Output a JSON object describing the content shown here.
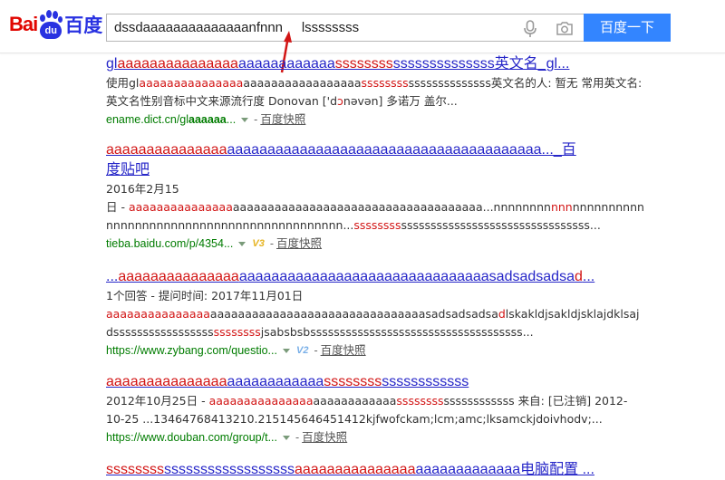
{
  "logo": {
    "latin": "Bai",
    "paw": "du",
    "cn": "百度"
  },
  "search": {
    "query": "dssdaaaaaaaaaaaaaanfnnn     lssssssss",
    "button_label": "百度一下"
  },
  "results": [
    {
      "title": [
        {
          "t": "gl",
          "r": false
        },
        {
          "t": "aaaaaaaaaaaaaaa",
          "r": true
        },
        {
          "t": "aaaaaaaaaaaa",
          "r": false
        },
        {
          "t": "ssssssss",
          "r": true
        },
        {
          "t": "ssssssssssssss英文名_gl...",
          "r": false
        }
      ],
      "abstract": [
        [
          {
            "t": "使用gl",
            "r": false
          },
          {
            "t": "aaaaaaaaaaaaaaa",
            "r": true
          },
          {
            "t": "aaaaaaaaaaaaaaaaa",
            "r": false
          },
          {
            "t": "ssssssss",
            "r": true
          },
          {
            "t": "ssssssssssssss英文名的人: 暂无 常用英文名:",
            "r": false
          }
        ],
        [
          {
            "t": "英文名性别音标中文来源流行度 Donovan ['d",
            "r": false
          },
          {
            "t": "ɔ",
            "r": true
          },
          {
            "t": "nəvən] 多诺万 盖尔...",
            "r": false
          }
        ]
      ],
      "url": [
        {
          "t": "ename.dict.cn/gl",
          "b": false
        },
        {
          "t": "aaaaaa",
          "b": true
        },
        {
          "t": "...",
          "b": false
        }
      ],
      "badge": "",
      "snapshot": "百度快照"
    },
    {
      "title": [
        {
          "t": "aaaaaaaaaaaaaaa",
          "r": true
        },
        {
          "t": "aaaaaaaaaaaaaaaaaaaaaaaaaaaaaaaaaaaaaaa..._百度贴吧",
          "r": false
        }
      ],
      "date": "2016年2月15",
      "abstract": [
        [
          {
            "t": "日 - ",
            "r": false
          },
          {
            "t": "aaaaaaaaaaaaaaa",
            "r": true
          },
          {
            "t": "aaaaaaaaaaaaaaaaaaaaaaaaaaaaaaaaaaaa...nnnnnnnn",
            "r": false
          },
          {
            "t": "nnn",
            "r": true
          },
          {
            "t": "nnnnnnnnnn",
            "r": false
          }
        ],
        [
          {
            "t": "nnnnnnnnnnnnnnnnnnnnnnnnnnnnnnnnn...",
            "r": false
          },
          {
            "t": "ssssssss",
            "r": true
          },
          {
            "t": "ssssssssssssssssssssssssssssssss...",
            "r": false
          }
        ]
      ],
      "url": [
        {
          "t": "tieba.baidu.com/p/4354...",
          "b": false
        }
      ],
      "badge": "V3",
      "snapshot": "百度快照"
    },
    {
      "title": [
        {
          "t": "...",
          "r": false
        },
        {
          "t": "aaaaaaaaaaaaaaa",
          "r": true
        },
        {
          "t": "aaaaaaaaaaaaaaaaaaaaaaaaaaaaaaasadsadsadsa",
          "r": false
        },
        {
          "t": "d",
          "r": true
        },
        {
          "t": "...",
          "r": false
        }
      ],
      "date": "1个回答 - 提问时间: 2017年11月01日",
      "abstract": [
        [
          {
            "t": "aaaaaaaaaaaaaaa",
            "r": true
          },
          {
            "t": "aaaaaaaaaaaaaaaaaaaaaaaaaaaaaaasadsadsadsa",
            "r": false
          },
          {
            "t": "d",
            "r": true
          },
          {
            "t": "lskakldjsakldjsklajdklsaj",
            "r": false
          }
        ],
        [
          {
            "t": "dsssssssssssssssss",
            "r": false
          },
          {
            "t": "ssssssss",
            "r": true
          },
          {
            "t": "jsabsbsbssssssssssssssssssssssssssssssssssss...",
            "r": false
          }
        ]
      ],
      "url": [
        {
          "t": "https://www.zybang.com/questio...",
          "b": false
        }
      ],
      "badge": "V2",
      "snapshot": "百度快照"
    },
    {
      "title": [
        {
          "t": "aaaaaaaaaaaaaaa",
          "r": true
        },
        {
          "t": "aaaaaaaaaaaa",
          "r": false
        },
        {
          "t": "ssssssss",
          "r": true
        },
        {
          "t": "ssssssssssss",
          "r": false
        }
      ],
      "date": "2012年10月25日 - ",
      "abstract": [
        [
          {
            "t": "aaaaaaaaaaaaaaa",
            "r": true
          },
          {
            "t": "aaaaaaaaaaaa",
            "r": false
          },
          {
            "t": "ssssssss",
            "r": true
          },
          {
            "t": "ssssssssssss 来自: [已注销] 2012-",
            "r": false
          }
        ],
        [
          {
            "t": "10-25 ...13464768413210.215145646451412kjfwofckam;lcm;amc;lksamckjdoivhodv;...",
            "r": false
          }
        ]
      ],
      "url": [
        {
          "t": "https://www.douban.com/group/t...",
          "b": false
        }
      ],
      "badge": "",
      "snapshot": "百度快照"
    },
    {
      "title": [
        {
          "t": "ssssssss",
          "r": true
        },
        {
          "t": "ssssssssssssssssss",
          "r": false
        },
        {
          "t": "aaaaaaaaaaaaaaa",
          "r": true
        },
        {
          "t": "aaaaaaaaaaaaa电脑配置 ...",
          "r": false
        }
      ]
    }
  ],
  "colors": {
    "accent": "#3385ff",
    "link": "#2626c8",
    "highlight": "#d21515",
    "url": "#007c00",
    "logo_red": "#e10601",
    "logo_blue": "#2932e1",
    "arrow": "#d21515"
  }
}
